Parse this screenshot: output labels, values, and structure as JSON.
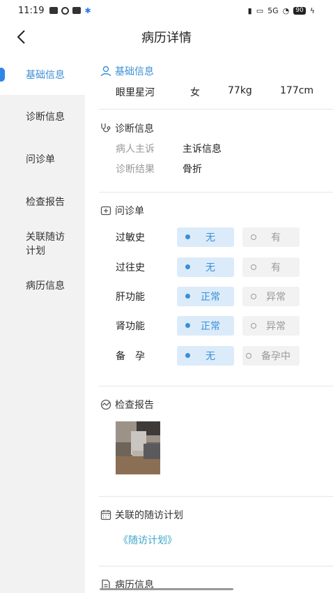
{
  "status_bar": {
    "time": "11:19",
    "network": "5G",
    "battery": "90"
  },
  "header": {
    "title": "病历详情"
  },
  "sidebar": {
    "items": [
      {
        "label": "基础信息",
        "active": true
      },
      {
        "label": "诊断信息",
        "active": false
      },
      {
        "label": "问诊单",
        "active": false
      },
      {
        "label": "检查报告",
        "active": false
      },
      {
        "label": "关联随访计划",
        "active": false
      },
      {
        "label": "病历信息",
        "active": false
      }
    ]
  },
  "basic_info": {
    "title": "基础信息",
    "name": "眼里星河",
    "gender": "女",
    "weight": "77kg",
    "height": "177cm"
  },
  "diagnosis": {
    "title": "诊断信息",
    "complaint_label": "病人主诉",
    "complaint_value": "主诉信息",
    "result_label": "诊断结果",
    "result_value": "骨折"
  },
  "inquiry": {
    "title": "问诊单",
    "rows": [
      {
        "label": "过敏史",
        "options": [
          "无",
          "有"
        ],
        "selected": 0
      },
      {
        "label": "过往史",
        "options": [
          "无",
          "有"
        ],
        "selected": 0
      },
      {
        "label": "肝功能",
        "options": [
          "正常",
          "异常"
        ],
        "selected": 0
      },
      {
        "label": "肾功能",
        "options": [
          "正常",
          "异常"
        ],
        "selected": 0
      },
      {
        "label": "备　孕",
        "options": [
          "无",
          "备孕中"
        ],
        "selected": 0
      }
    ]
  },
  "report": {
    "title": "检查报告"
  },
  "followup": {
    "title": "关联的随访计划",
    "link": "《随访计划》"
  },
  "record": {
    "title": "病历信息"
  },
  "colors": {
    "accent": "#3a8fd6",
    "selected_bg": "#dcebfa",
    "link": "#3aa6c9",
    "sidebar_bg": "#f2f2f2"
  }
}
